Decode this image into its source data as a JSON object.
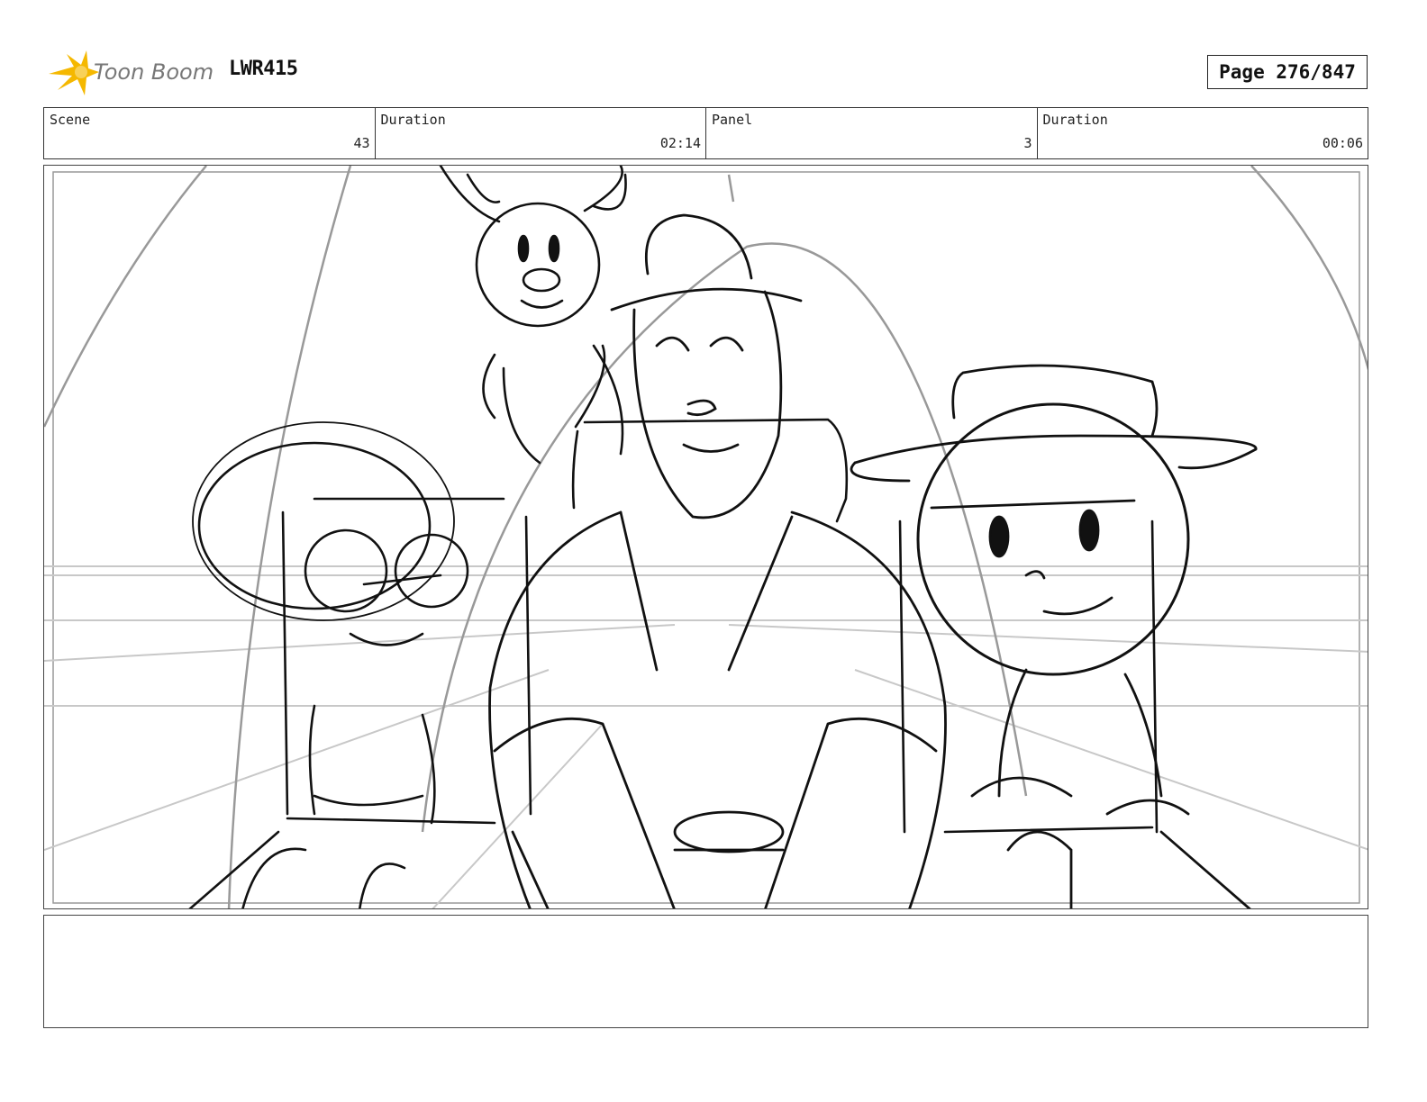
{
  "header": {
    "brand": "Toon Boom",
    "brand_icon": "toon-boom-star-icon",
    "brand_color": "#f5b800",
    "project_code": "LWR415",
    "page_label": "Page 276/847"
  },
  "info": {
    "scene_label": "Scene",
    "scene_value": "43",
    "scene_duration_label": "Duration",
    "scene_duration_value": "02:14",
    "panel_label": "Panel",
    "panel_value": "3",
    "panel_duration_label": "Duration",
    "panel_duration_value": "00:06"
  },
  "panel": {
    "content": "storyboard sketch"
  },
  "notes": {
    "text": ""
  }
}
